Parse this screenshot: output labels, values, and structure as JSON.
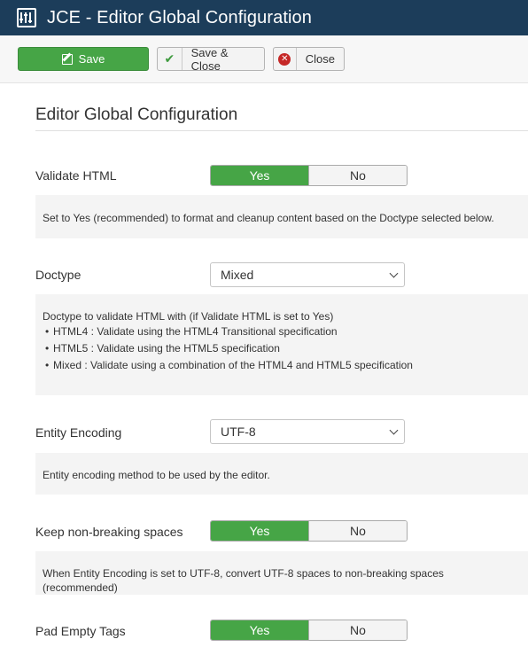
{
  "window": {
    "title": "JCE - Editor Global Configuration"
  },
  "toolbar": {
    "save_label": "Save",
    "save_close_label": "Save & Close",
    "close_label": "Close"
  },
  "page": {
    "heading": "Editor Global Configuration"
  },
  "fields": {
    "validate_html": {
      "label": "Validate HTML",
      "value": "Yes",
      "yes": "Yes",
      "no": "No",
      "description": "Set to Yes (recommended) to format and cleanup content based on the Doctype selected below."
    },
    "doctype": {
      "label": "Doctype",
      "value": "Mixed",
      "description": "Doctype to validate HTML with (if Validate HTML is set to Yes)",
      "items": [
        "HTML4 : Validate using the HTML4 Transitional specification",
        "HTML5 : Validate using the HTML5 specification",
        "Mixed : Validate using a combination of the HTML4 and HTML5 specification"
      ]
    },
    "entity_encoding": {
      "label": "Entity Encoding",
      "value": "UTF-8",
      "description": "Entity encoding method to be used by the editor."
    },
    "keep_nbsp": {
      "label": "Keep non-breaking spaces",
      "value": "Yes",
      "yes": "Yes",
      "no": "No",
      "description": "When Entity Encoding is set to UTF-8, convert UTF-8 spaces to non-breaking spaces (recommended)"
    },
    "pad_empty_tags": {
      "label": "Pad Empty Tags",
      "value": "Yes",
      "yes": "Yes",
      "no": "No"
    }
  },
  "colors": {
    "title_bar": "#1c3d5a",
    "success_green": "#46a546",
    "close_red": "#c52827",
    "description_bg": "#f4f4f4"
  },
  "icons": {
    "app": "sliders-icon",
    "save": "edit-icon",
    "save_close": "check-icon",
    "close": "close-circle-icon",
    "select": "chevron-down-icon"
  }
}
